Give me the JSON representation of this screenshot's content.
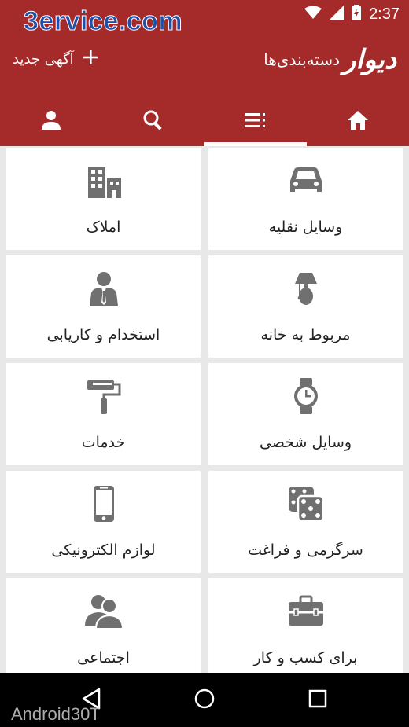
{
  "status_bar": {
    "time": "2:37",
    "watermark": "3ervice.com"
  },
  "toolbar": {
    "brand": "دیوار",
    "title": "دسته‌بندی‌ها",
    "new_ad_label": "آگهی جدید"
  },
  "tabs": [
    {
      "name": "profile",
      "icon": "person-icon"
    },
    {
      "name": "search",
      "icon": "search-icon"
    },
    {
      "name": "categories",
      "icon": "list-icon",
      "active": true
    },
    {
      "name": "home",
      "icon": "home-icon"
    }
  ],
  "categories": [
    {
      "label": "وسایل نقلیه",
      "icon": "car-icon"
    },
    {
      "label": "املاک",
      "icon": "buildings-icon"
    },
    {
      "label": "مربوط به خانه",
      "icon": "lamp-icon"
    },
    {
      "label": "استخدام و کاریابی",
      "icon": "businessman-icon"
    },
    {
      "label": "وسایل شخصی",
      "icon": "watch-icon"
    },
    {
      "label": "خدمات",
      "icon": "paint-roller-icon"
    },
    {
      "label": "سرگرمی و فراغت",
      "icon": "dice-icon"
    },
    {
      "label": "لوازم الکترونیکی",
      "icon": "phone-icon"
    },
    {
      "label": "برای کسب و کار",
      "icon": "briefcase-icon"
    },
    {
      "label": "اجتماعی",
      "icon": "people-icon"
    }
  ],
  "bottom_watermark": "Android30T",
  "colors": {
    "primary": "#a52a2a",
    "icon_gray": "#707070",
    "background": "#e8e8e8"
  }
}
